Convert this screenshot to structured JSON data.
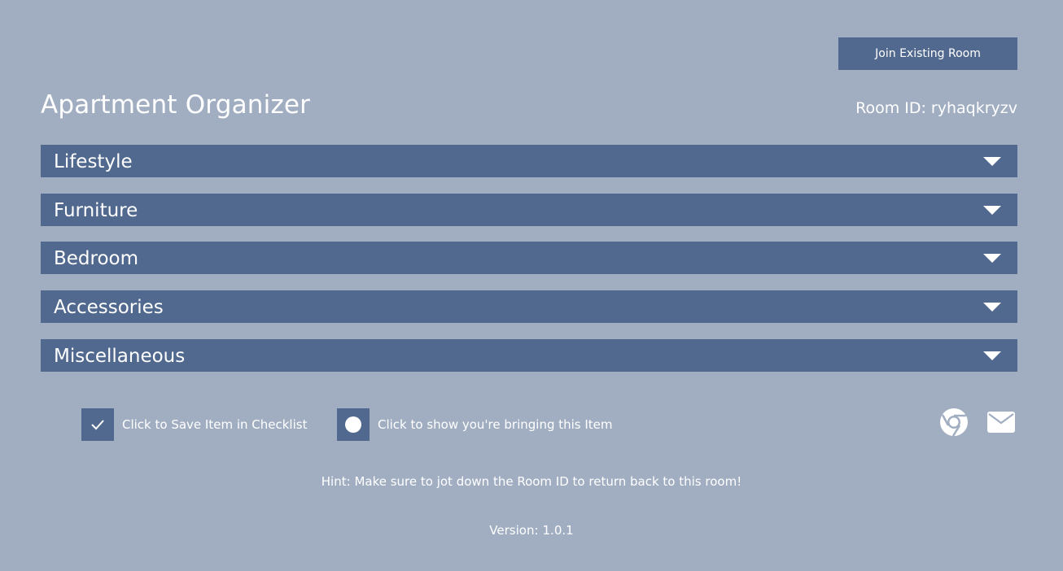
{
  "header": {
    "join_button_label": "Join Existing Room",
    "title": "Apartment Organizer",
    "room_id_label": "Room ID:",
    "room_id_value": "ryhaqkryzv"
  },
  "sections": [
    {
      "label": "Lifestyle",
      "icon": "chevron-down-icon"
    },
    {
      "label": "Furniture",
      "icon": "chevron-down-icon"
    },
    {
      "label": "Bedroom",
      "icon": "chevron-down-icon"
    },
    {
      "label": "Accessories",
      "icon": "chevron-down-icon"
    },
    {
      "label": "Miscellaneous",
      "icon": "chevron-down-icon"
    }
  ],
  "legend": {
    "save_text": "Click to Save Item in Checklist",
    "save_icon": "checkmark-icon",
    "bring_text": "Click to show you're bringing this Item",
    "bring_icon": "circle-icon"
  },
  "share": {
    "icons": [
      "chrome-icon",
      "mail-icon"
    ]
  },
  "footer": {
    "hint": "Hint: Make sure to jot down the Room ID to return back to this room!",
    "version_label": "Version:",
    "version_value": "1.0.1"
  },
  "colors": {
    "background": "#a1aec2",
    "accent": "#51698f",
    "text": "#ffffff"
  }
}
